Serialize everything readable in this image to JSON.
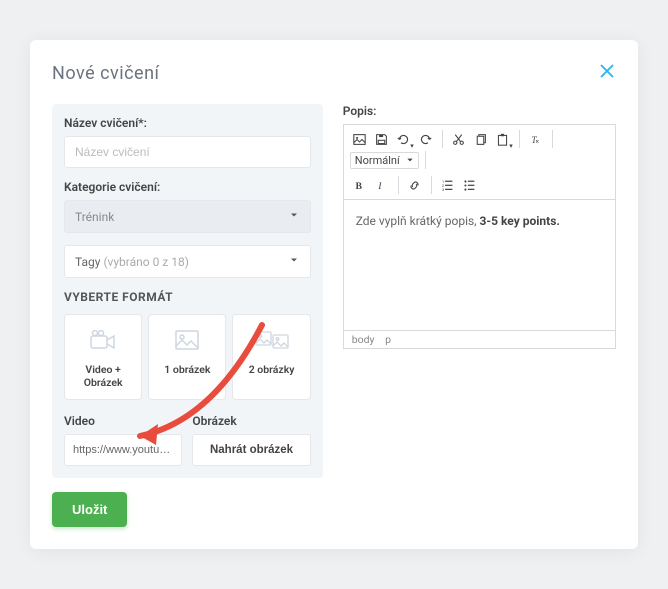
{
  "modal": {
    "title": "Nové cvičení"
  },
  "left": {
    "name_label": "Název cvičení*:",
    "name_placeholder": "Název cvičení",
    "category_label": "Kategorie cvičení:",
    "category_value": "Trénink",
    "tags_label": "Tagy",
    "tags_suffix": "(vybráno 0 z 18)",
    "format_title": "VYBERTE FORMÁT",
    "formats": [
      {
        "label": "Video + Obrázek"
      },
      {
        "label": "1 obrázek"
      },
      {
        "label": "2 obrázky"
      }
    ],
    "video_label": "Video",
    "video_value": "https://www.youtube.com/wa",
    "image_label": "Obrázek",
    "upload_btn": "Nahrát obrázek"
  },
  "right": {
    "desc_label": "Popis:",
    "style_select": "Normální",
    "content_prefix": "Zde vyplň krátký popis, ",
    "content_bold": "3-5 key points.",
    "path_body": "body",
    "path_p": "p"
  },
  "save": "Uložit"
}
